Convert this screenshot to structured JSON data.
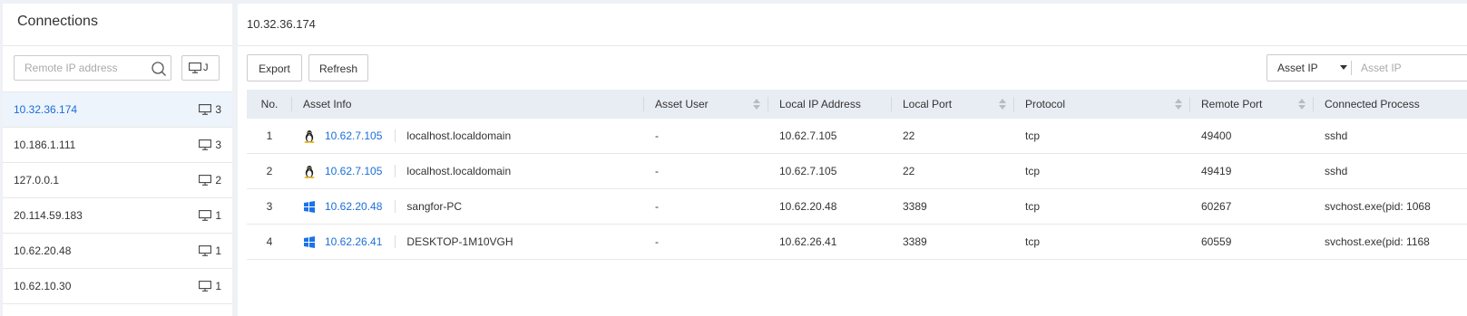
{
  "left": {
    "title": "Connections",
    "search_placeholder": "Remote IP address",
    "view_label": "J"
  },
  "connections": [
    {
      "ip": "10.32.36.174",
      "count": "3",
      "active": true
    },
    {
      "ip": "10.186.1.111",
      "count": "3"
    },
    {
      "ip": "127.0.0.1",
      "count": "2"
    },
    {
      "ip": "20.114.59.183",
      "count": "1"
    },
    {
      "ip": "10.62.20.48",
      "count": "1"
    },
    {
      "ip": "10.62.10.30",
      "count": "1"
    }
  ],
  "right": {
    "title": "10.32.36.174",
    "export_label": "Export",
    "refresh_label": "Refresh",
    "filter_select": "Asset IP",
    "filter_placeholder": "Asset IP"
  },
  "table": {
    "headers": {
      "no": "No.",
      "asset_info": "Asset Info",
      "asset_user": "Asset User",
      "local_ip": "Local IP Address",
      "local_port": "Local Port",
      "protocol": "Protocol",
      "remote_port": "Remote Port",
      "process": "Connected Process"
    },
    "rows": [
      {
        "no": "1",
        "os": "linux",
        "asset_ip": "10.62.7.105",
        "host": "localhost.localdomain",
        "user": "-",
        "local_ip": "10.62.7.105",
        "local_port": "22",
        "protocol": "tcp",
        "remote_port": "49400",
        "process": "sshd"
      },
      {
        "no": "2",
        "os": "linux",
        "asset_ip": "10.62.7.105",
        "host": "localhost.localdomain",
        "user": "-",
        "local_ip": "10.62.7.105",
        "local_port": "22",
        "protocol": "tcp",
        "remote_port": "49419",
        "process": "sshd"
      },
      {
        "no": "3",
        "os": "windows",
        "asset_ip": "10.62.20.48",
        "host": "sangfor-PC",
        "user": "-",
        "local_ip": "10.62.20.48",
        "local_port": "3389",
        "protocol": "tcp",
        "remote_port": "60267",
        "process": "svchost.exe(pid: 1068"
      },
      {
        "no": "4",
        "os": "windows",
        "asset_ip": "10.62.26.41",
        "host": "DESKTOP-1M10VGH",
        "user": "-",
        "local_ip": "10.62.26.41",
        "local_port": "3389",
        "protocol": "tcp",
        "remote_port": "60559",
        "process": "svchost.exe(pid: 1168"
      }
    ]
  }
}
